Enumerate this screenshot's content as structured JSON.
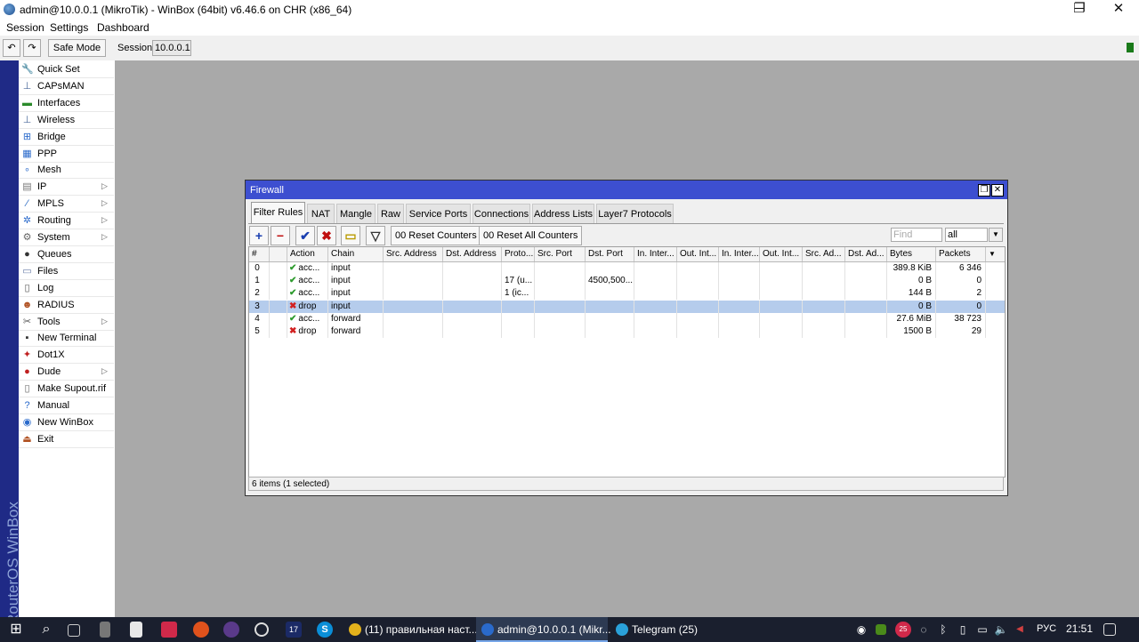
{
  "window": {
    "title": "admin@10.0.0.1 (MikroTik) - WinBox (64bit) v6.46.6 on CHR (x86_64)",
    "minimize": "─",
    "maximize": "❐",
    "close": "✕"
  },
  "menubar": {
    "session": "Session",
    "settings": "Settings",
    "dashboard": "Dashboard"
  },
  "toolbar": {
    "undo_icon": "↶",
    "redo_icon": "↷",
    "safe_mode": "Safe Mode",
    "session_label": "Session:",
    "session_value": "10.0.0.1"
  },
  "sidebar": {
    "vertical_text": "RouterOS WinBox",
    "items": [
      {
        "label": "Quick Set",
        "icon": "🔧",
        "submenu": false
      },
      {
        "label": "CAPsMAN",
        "icon": "⊥",
        "submenu": false
      },
      {
        "label": "Interfaces",
        "icon": "▬",
        "submenu": false
      },
      {
        "label": "Wireless",
        "icon": "⊥",
        "submenu": false
      },
      {
        "label": "Bridge",
        "icon": "⊞",
        "submenu": false
      },
      {
        "label": "PPP",
        "icon": "▦",
        "submenu": false
      },
      {
        "label": "Mesh",
        "icon": "∘",
        "submenu": false
      },
      {
        "label": "IP",
        "icon": "▤",
        "submenu": true
      },
      {
        "label": "MPLS",
        "icon": "⁄",
        "submenu": true
      },
      {
        "label": "Routing",
        "icon": "✲",
        "submenu": true
      },
      {
        "label": "System",
        "icon": "⚙",
        "submenu": true
      },
      {
        "label": "Queues",
        "icon": "●",
        "submenu": false
      },
      {
        "label": "Files",
        "icon": "▭",
        "submenu": false
      },
      {
        "label": "Log",
        "icon": "▯",
        "submenu": false
      },
      {
        "label": "RADIUS",
        "icon": "☻",
        "submenu": false
      },
      {
        "label": "Tools",
        "icon": "✂",
        "submenu": true
      },
      {
        "label": "New Terminal",
        "icon": "▪",
        "submenu": false
      },
      {
        "label": "Dot1X",
        "icon": "✦",
        "submenu": false
      },
      {
        "label": "Dude",
        "icon": "●",
        "submenu": true
      },
      {
        "label": "Make Supout.rif",
        "icon": "▯",
        "submenu": false
      },
      {
        "label": "Manual",
        "icon": "?",
        "submenu": false
      },
      {
        "label": "New WinBox",
        "icon": "◉",
        "submenu": false
      },
      {
        "label": "Exit",
        "icon": "⏏",
        "submenu": false
      }
    ],
    "submenu_arrow": "▷"
  },
  "firewall": {
    "title": "Firewall",
    "restore_icon": "❐",
    "close_icon": "✕",
    "tabs": [
      "Filter Rules",
      "NAT",
      "Mangle",
      "Raw",
      "Service Ports",
      "Connections",
      "Address Lists",
      "Layer7 Protocols"
    ],
    "active_tab": 0,
    "buttons": {
      "add": "+",
      "remove": "−",
      "enable": "✔",
      "disable": "✖",
      "comment": "▭",
      "filter": "▽",
      "reset_counters": "00 Reset Counters",
      "reset_all_counters": "00 Reset All Counters"
    },
    "find_placeholder": "Find",
    "filter_select": "all",
    "dropdown_icon": "▼",
    "columns": [
      "#",
      "",
      "Action",
      "Chain",
      "Src. Address",
      "Dst. Address",
      "Proto...",
      "Src. Port",
      "Dst. Port",
      "In. Inter...",
      "Out. Int...",
      "In. Inter...",
      "Out. Int...",
      "Src. Ad...",
      "Dst. Ad...",
      "Bytes",
      "Packets"
    ],
    "rows": [
      {
        "num": "0",
        "action_icon": "✔",
        "action": "acc...",
        "chain": "input",
        "proto": "",
        "dst_port": "",
        "bytes": "389.8 KiB",
        "packets": "6 346",
        "ok": true,
        "selected": false
      },
      {
        "num": "1",
        "action_icon": "✔",
        "action": "acc...",
        "chain": "input",
        "proto": "17 (u...",
        "dst_port": "4500,500...",
        "bytes": "0 B",
        "packets": "0",
        "ok": true,
        "selected": false
      },
      {
        "num": "2",
        "action_icon": "✔",
        "action": "acc...",
        "chain": "input",
        "proto": "1 (ic...",
        "dst_port": "",
        "bytes": "144 B",
        "packets": "2",
        "ok": true,
        "selected": false
      },
      {
        "num": "3",
        "action_icon": "✖",
        "action": "drop",
        "chain": "input",
        "proto": "",
        "dst_port": "",
        "bytes": "0 B",
        "packets": "0",
        "ok": false,
        "selected": true
      },
      {
        "num": "4",
        "action_icon": "✔",
        "action": "acc...",
        "chain": "forward",
        "proto": "",
        "dst_port": "",
        "bytes": "27.6 MiB",
        "packets": "38 723",
        "ok": true,
        "selected": false
      },
      {
        "num": "5",
        "action_icon": "✖",
        "action": "drop",
        "chain": "forward",
        "proto": "",
        "dst_port": "",
        "bytes": "1500 B",
        "packets": "29",
        "ok": false,
        "selected": false
      }
    ],
    "status": "6 items (1 selected)"
  },
  "taskbar": {
    "start_icon": "⊞",
    "search_icon": "⌕",
    "apps": [
      {
        "label": "(11) правильная наст...",
        "active": false
      },
      {
        "label": "admin@10.0.0.1 (Mikr...",
        "active": true
      },
      {
        "label": "Telegram (25)",
        "active": false
      }
    ],
    "badge_count": "25",
    "pinned_badge": "17",
    "language": "РУС",
    "time": "21:51"
  },
  "colors": {
    "accent_blue": "#3d4fd0",
    "sidebar_strip": "#1f2a86",
    "selected_row": "#b5ccec",
    "accept_green": "#2e9b2e",
    "drop_red": "#d22020"
  }
}
